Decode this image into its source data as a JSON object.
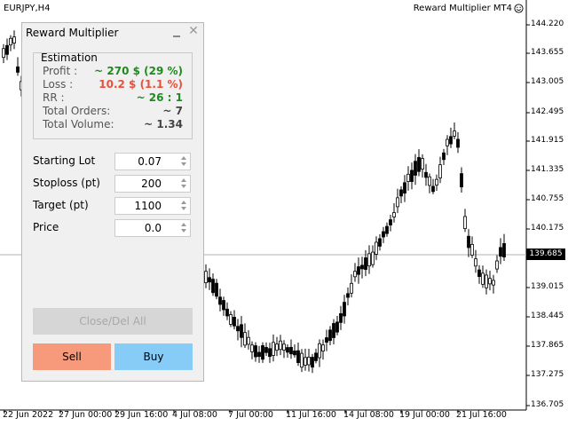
{
  "chart": {
    "symbol": "EURJPY,H4",
    "ea_name": "Reward Multiplier MT4",
    "current_price": "139.685",
    "y_ticks": [
      "144.220",
      "143.655",
      "143.005",
      "142.495",
      "141.915",
      "141.335",
      "140.755",
      "140.175",
      "139.015",
      "138.445",
      "137.865",
      "137.275",
      "136.705"
    ],
    "x_ticks": [
      "22 Jun 2022",
      "27 Jun 00:00",
      "29 Jun 16:00",
      "4 Jul 08:00",
      "7 Jul 00:00",
      "11 Jul 16:00",
      "14 Jul 08:00",
      "19 Jul 00:00",
      "21 Jul 16:00"
    ]
  },
  "panel": {
    "title": "Reward Multiplier",
    "estimation": {
      "title": "Estimation",
      "profit_label": "Profit :",
      "profit_value": "~ 270 $ (29 %)",
      "loss_label": "Loss :",
      "loss_value": "10.2 $ (1.1 %)",
      "rr_label": "RR :",
      "rr_value": "~ 26 : 1",
      "orders_label": "Total Orders:",
      "orders_value": "~ 7",
      "volume_label": "Total Volume:",
      "volume_value": "~ 1.34"
    },
    "inputs": {
      "lot_label": "Starting Lot",
      "lot_value": "0.07",
      "sl_label": "Stoploss (pt)",
      "sl_value": "200",
      "target_label": "Target (pt)",
      "target_value": "1100",
      "price_label": "Price",
      "price_value": "0.0"
    },
    "buttons": {
      "close_all": "Close/Del All",
      "sell": "Sell",
      "buy": "Buy"
    }
  },
  "colors": {
    "sell": "#f79a7b",
    "buy": "#87ccf7",
    "profit": "#1f8a1f",
    "loss": "#e8503c"
  }
}
